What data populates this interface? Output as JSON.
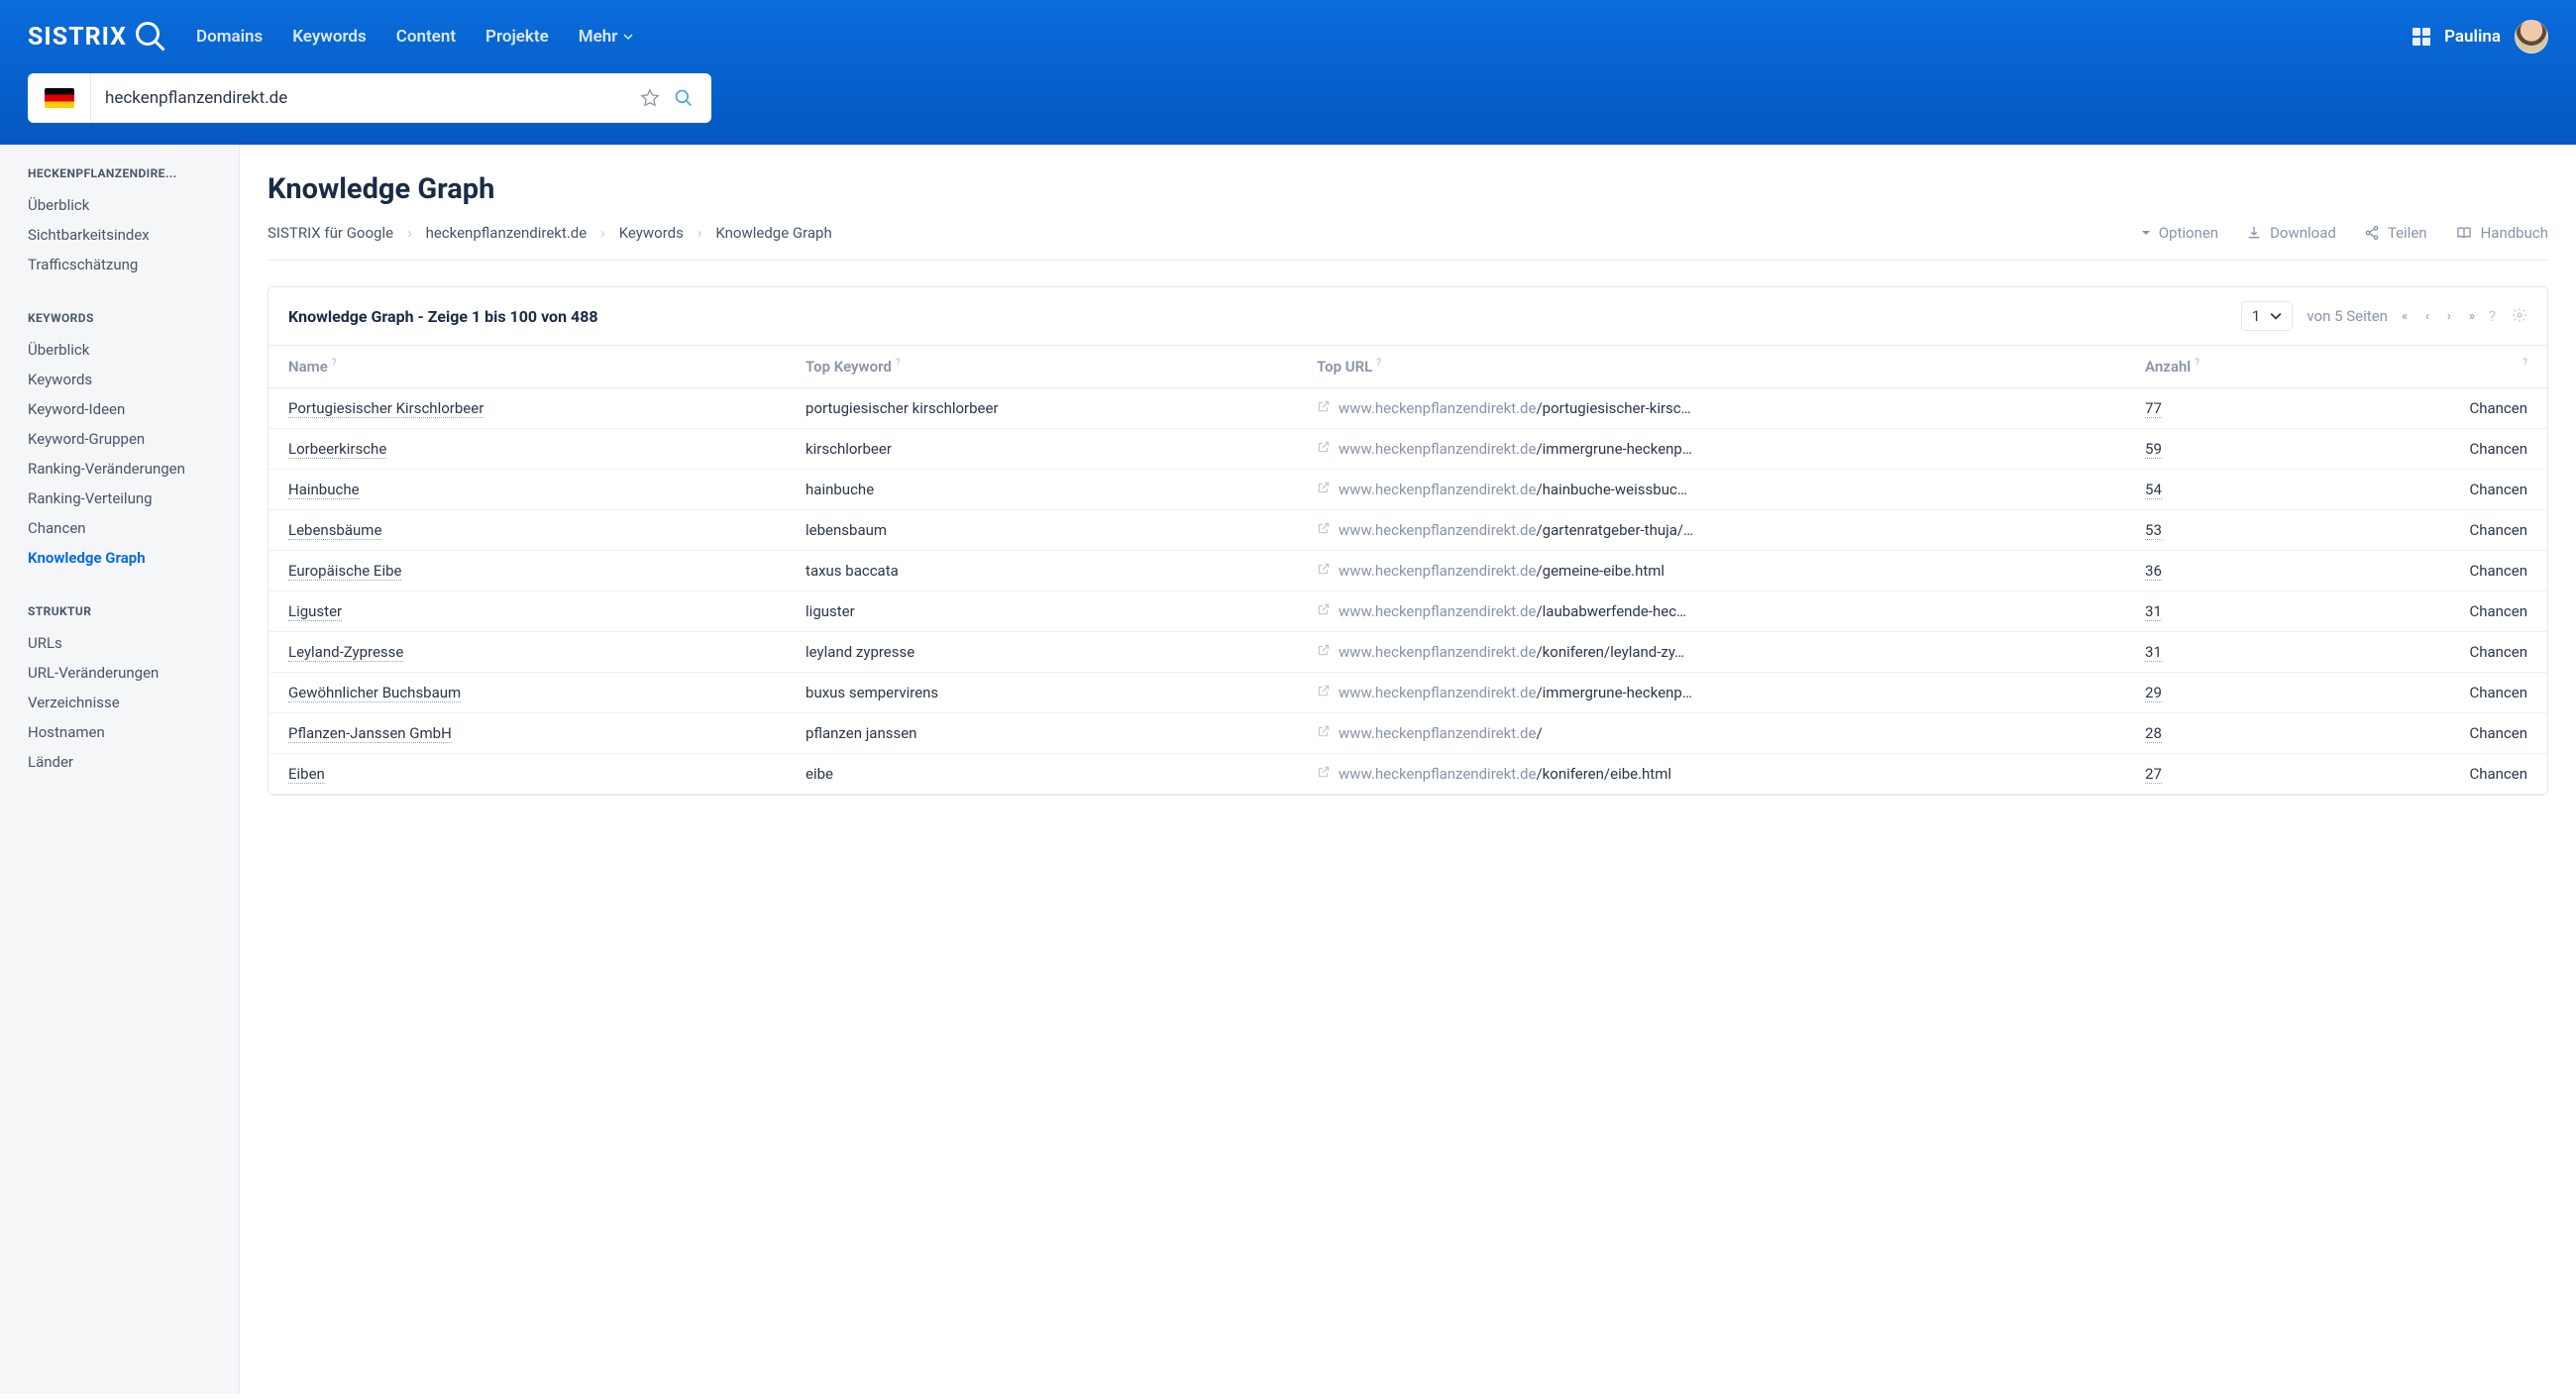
{
  "brand": "SISTRIX",
  "nav": {
    "domains": "Domains",
    "keywords": "Keywords",
    "content": "Content",
    "projekte": "Projekte",
    "mehr": "Mehr"
  },
  "user": {
    "name": "Paulina"
  },
  "search": {
    "value": "heckenpflanzendirekt.de"
  },
  "sidebar": {
    "section1": {
      "heading": "HECKENPFLANZENDIRE...",
      "items": [
        "Überblick",
        "Sichtbarkeitsindex",
        "Trafficschätzung"
      ]
    },
    "section2": {
      "heading": "KEYWORDS",
      "items": [
        "Überblick",
        "Keywords",
        "Keyword-Ideen",
        "Keyword-Gruppen",
        "Ranking-Veränderungen",
        "Ranking-Verteilung",
        "Chancen",
        "Knowledge Graph"
      ],
      "activeIndex": 7
    },
    "section3": {
      "heading": "STRUKTUR",
      "items": [
        "URLs",
        "URL-Veränderungen",
        "Verzeichnisse",
        "Hostnamen",
        "Länder"
      ]
    }
  },
  "page": {
    "title": "Knowledge Graph",
    "breadcrumb": [
      "SISTRIX für Google",
      "heckenpflanzendirekt.de",
      "Keywords",
      "Knowledge Graph"
    ],
    "actions": {
      "optionen": "Optionen",
      "download": "Download",
      "teilen": "Teilen",
      "handbuch": "Handbuch"
    }
  },
  "table": {
    "title": "Knowledge Graph - Zeige 1 bis 100 von 488",
    "page_current": "1",
    "page_total": "von 5 Seiten",
    "columns": {
      "name": "Name",
      "top_keyword": "Top Keyword",
      "top_url": "Top URL",
      "anzahl": "Anzahl"
    },
    "chancen_label": "Chancen",
    "url_domain": "www.heckenpflanzendirekt.de",
    "rows": [
      {
        "name": "Portugiesischer Kirschlorbeer",
        "kw": "portugiesischer kirschlorbeer",
        "path": "/portugiesischer-kirsc…",
        "count": "77"
      },
      {
        "name": "Lorbeerkirsche",
        "kw": "kirschlorbeer",
        "path": "/immergrune-heckenp…",
        "count": "59"
      },
      {
        "name": "Hainbuche",
        "kw": "hainbuche",
        "path": "/hainbuche-weissbuc…",
        "count": "54"
      },
      {
        "name": "Lebensbäume",
        "kw": "lebensbaum",
        "path": "/gartenratgeber-thuja/…",
        "count": "53"
      },
      {
        "name": "Europäische Eibe",
        "kw": "taxus baccata",
        "path": "/gemeine-eibe.html",
        "count": "36"
      },
      {
        "name": "Liguster",
        "kw": "liguster",
        "path": "/laubabwerfende-hec…",
        "count": "31"
      },
      {
        "name": "Leyland-Zypresse",
        "kw": "leyland zypresse",
        "path": "/koniferen/leyland-zy…",
        "count": "31"
      },
      {
        "name": "Gewöhnlicher Buchsbaum",
        "kw": "buxus sempervirens",
        "path": "/immergrune-heckenp…",
        "count": "29"
      },
      {
        "name": "Pflanzen-Janssen GmbH",
        "kw": "pflanzen janssen",
        "path": "/",
        "count": "28"
      },
      {
        "name": "Eiben",
        "kw": "eibe",
        "path": "/koniferen/eibe.html",
        "count": "27"
      }
    ]
  }
}
